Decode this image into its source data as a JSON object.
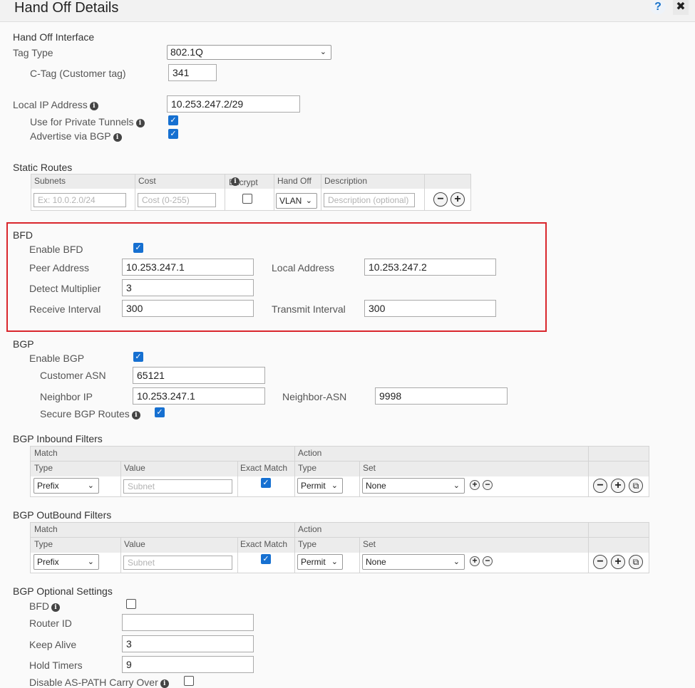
{
  "header": {
    "title": "Hand Off Details",
    "help": "?",
    "close": "✖"
  },
  "handoff": {
    "section": "Hand Off Interface",
    "tag_type_label": "Tag Type",
    "tag_type_value": "802.1Q",
    "ctag_label": "C-Tag (Customer tag)",
    "ctag_value": "341",
    "local_ip_label": "Local IP Address",
    "local_ip_value": "10.253.247.2/29",
    "private_tunnels_label": "Use for Private Tunnels",
    "advertise_label": "Advertise via BGP",
    "private_tunnels_checked": true,
    "advertise_checked": true
  },
  "static_routes": {
    "section": "Static Routes",
    "columns": [
      "Subnets",
      "Cost",
      "Encrypt",
      "Hand Off",
      "Description"
    ],
    "subnet_placeholder": "Ex: 10.0.2.0/24",
    "cost_placeholder": "Cost (0-255)",
    "handoff_value": "VLAN",
    "description_placeholder": "Description (optional)"
  },
  "bfd": {
    "section": "BFD",
    "enable_label": "Enable BFD",
    "peer_label": "Peer Address",
    "peer_value": "10.253.247.1",
    "local_label": "Local Address",
    "local_value": "10.253.247.2",
    "detect_label": "Detect Multiplier",
    "detect_value": "3",
    "receive_label": "Receive Interval",
    "receive_value": "300",
    "transmit_label": "Transmit Interval",
    "transmit_value": "300"
  },
  "bgp": {
    "section": "BGP",
    "enable_label": "Enable BGP",
    "asn_label": "Customer ASN",
    "asn_value": "65121",
    "neighbor_ip_label": "Neighbor IP",
    "neighbor_ip_value": "10.253.247.1",
    "neighbor_asn_label": "Neighbor-ASN",
    "neighbor_asn_value": "9998",
    "secure_label": "Secure BGP Routes"
  },
  "inbound": {
    "section": "BGP Inbound Filters",
    "match": "Match",
    "action": "Action",
    "type": "Type",
    "value": "Value",
    "exact": "Exact Match",
    "action_type": "Type",
    "set": "Set",
    "type_value": "Prefix",
    "value_placeholder": "Subnet",
    "action_value": "Permit",
    "set_value": "None"
  },
  "outbound": {
    "section": "BGP OutBound Filters",
    "match": "Match",
    "action": "Action",
    "type": "Type",
    "value": "Value",
    "exact": "Exact Match",
    "action_type": "Type",
    "set": "Set",
    "type_value": "Prefix",
    "value_placeholder": "Subnet",
    "action_value": "Permit",
    "set_value": "None"
  },
  "optional": {
    "section": "BGP Optional Settings",
    "bfd_label": "BFD",
    "router_id_label": "Router ID",
    "router_id_value": "",
    "keepalive_label": "Keep Alive",
    "keepalive_value": "3",
    "hold_label": "Hold Timers",
    "hold_value": "9",
    "aspath_label": "Disable AS-PATH Carry Over"
  },
  "glyphs": {
    "check": "✓",
    "caret": "⌄",
    "minus": "−",
    "plus": "+",
    "info": "i",
    "copy": "⧉"
  },
  "colors": {
    "accent": "#1670d1",
    "highlight_border": "#d9262c"
  }
}
